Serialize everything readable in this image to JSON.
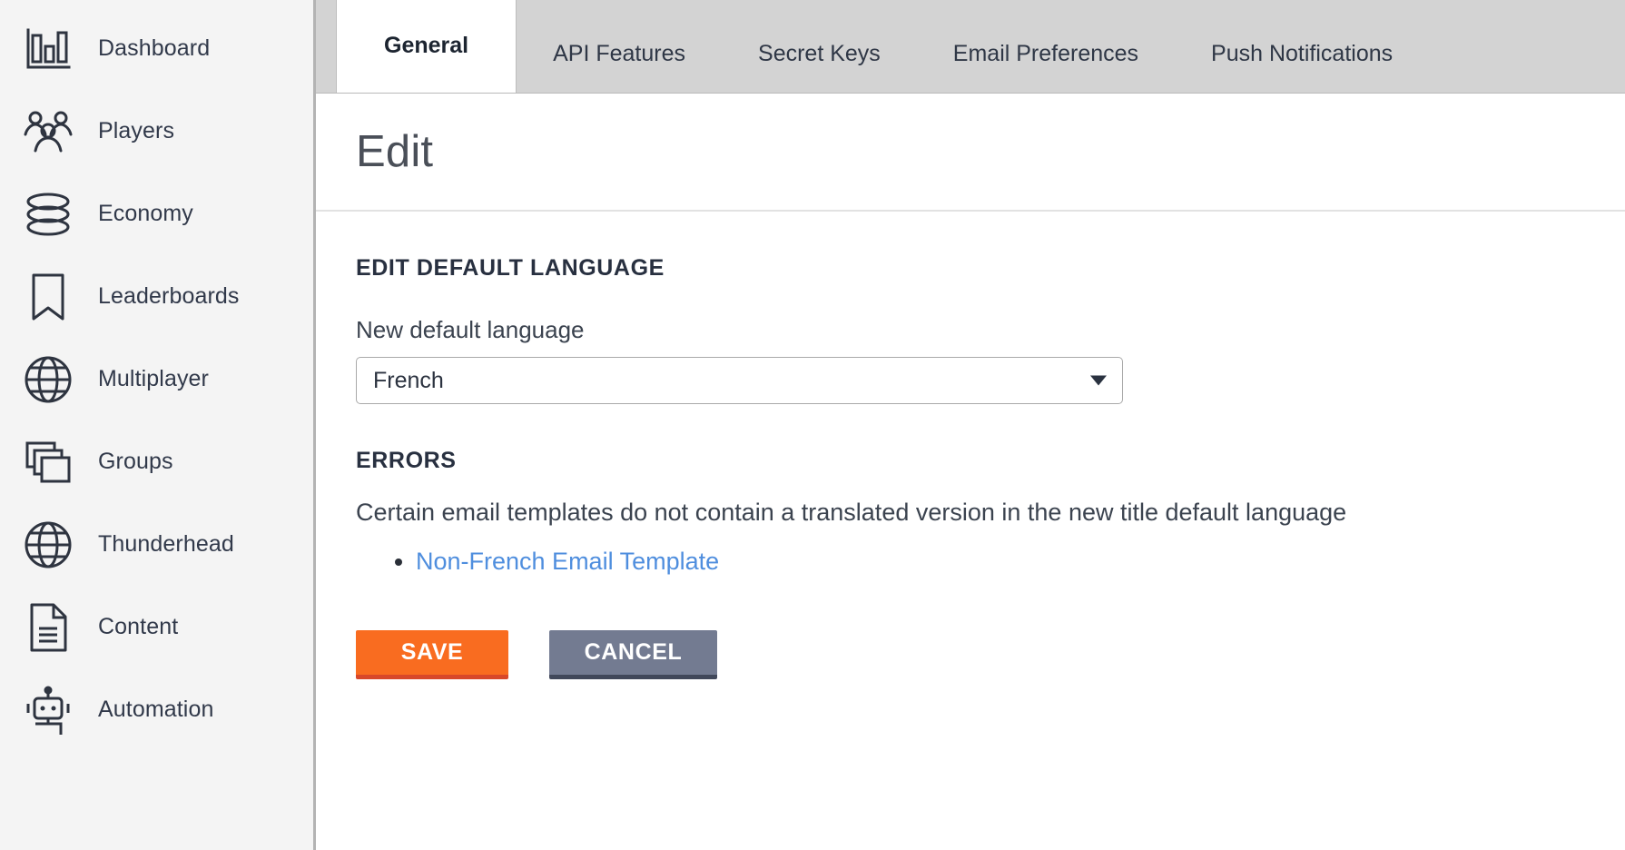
{
  "sidebar": {
    "items": [
      {
        "label": "Dashboard",
        "icon": "bar-chart-icon"
      },
      {
        "label": "Players",
        "icon": "people-group-icon"
      },
      {
        "label": "Economy",
        "icon": "coins-stack-icon"
      },
      {
        "label": "Leaderboards",
        "icon": "bookmark-icon"
      },
      {
        "label": "Multiplayer",
        "icon": "globe-icon"
      },
      {
        "label": "Groups",
        "icon": "stacked-windows-icon"
      },
      {
        "label": "Thunderhead",
        "icon": "globe-icon"
      },
      {
        "label": "Content",
        "icon": "document-lines-icon"
      },
      {
        "label": "Automation",
        "icon": "robot-icon"
      }
    ]
  },
  "tabs": [
    {
      "label": "General",
      "active": true
    },
    {
      "label": "API Features",
      "active": false
    },
    {
      "label": "Secret Keys",
      "active": false
    },
    {
      "label": "Email Preferences",
      "active": false
    },
    {
      "label": "Push Notifications",
      "active": false
    }
  ],
  "page": {
    "title": "Edit"
  },
  "form": {
    "section_title": "EDIT DEFAULT LANGUAGE",
    "language_label": "New default language",
    "language_value": "French",
    "language_options": [
      "French"
    ]
  },
  "errors": {
    "title": "ERRORS",
    "message": "Certain email templates do not contain a translated version in the new title default language",
    "items": [
      {
        "label": "Non-French Email Template"
      }
    ]
  },
  "buttons": {
    "save": "SAVE",
    "cancel": "CANCEL"
  },
  "colors": {
    "accent_orange": "#f96c20",
    "accent_orange_shadow": "#d8482a",
    "cancel_gray": "#737b91",
    "cancel_gray_shadow": "#41485a",
    "link_blue": "#4f8ede",
    "sidebar_bg": "#f4f4f4",
    "tabstrip_bg": "#d3d3d3",
    "text_dark": "#31394a"
  }
}
